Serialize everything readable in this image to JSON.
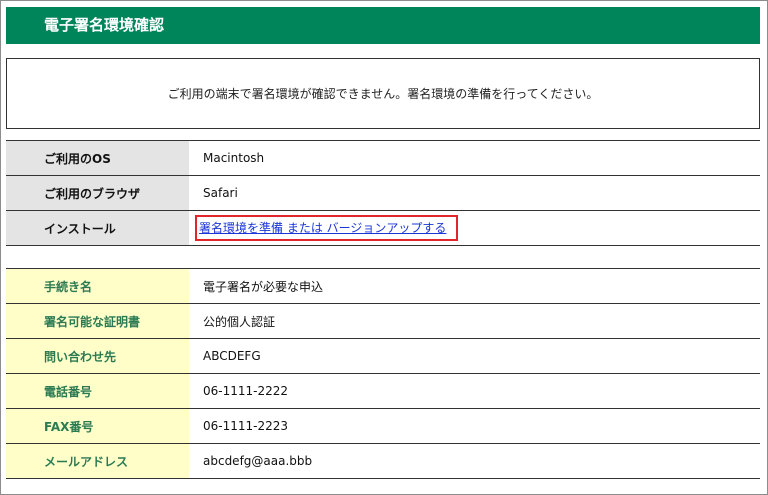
{
  "header": {
    "title": "電子署名環境確認"
  },
  "message": "ご利用の端末で署名環境が確認できません。署名環境の準備を行ってください。",
  "environment": {
    "os_label": "ご利用のOS",
    "os_value": "Macintosh",
    "browser_label": "ご利用のブラウザ",
    "browser_value": "Safari",
    "install_label": "インストール",
    "install_link": "署名環境を準備 または バージョンアップする"
  },
  "procedure": {
    "rows": [
      {
        "label": "手続き名",
        "value": "電子署名が必要な申込"
      },
      {
        "label": "署名可能な証明書",
        "value": "公的個人認証"
      },
      {
        "label": "問い合わせ先",
        "value": "ABCDEFG"
      },
      {
        "label": "電話番号",
        "value": "06-1111-2222"
      },
      {
        "label": "FAX番号",
        "value": "06-1111-2223"
      },
      {
        "label": "メールアドレス",
        "value": "abcdefg@aaa.bbb"
      }
    ]
  },
  "colors": {
    "header_bg": "#00845a",
    "link": "#1a35d8",
    "highlight_border": "#e0262a",
    "env_label_bg": "#e4e4e4",
    "procedure_label_bg": "#fffec9"
  }
}
